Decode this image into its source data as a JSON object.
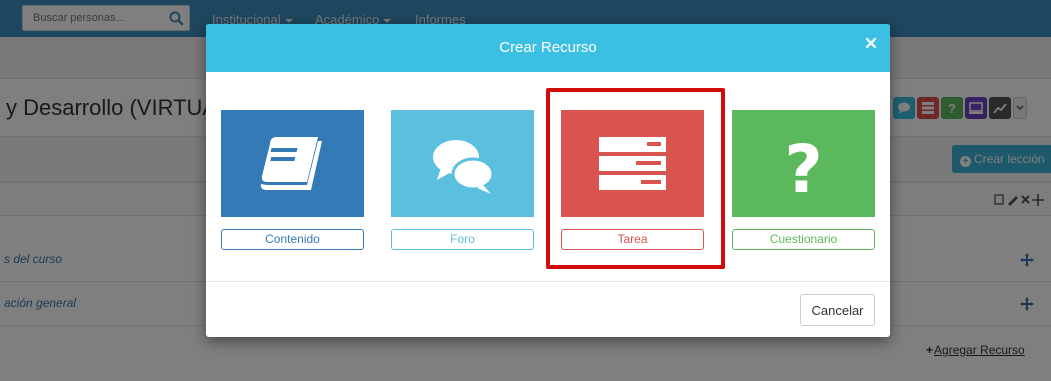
{
  "topbar": {
    "search_placeholder": "Buscar personas...",
    "nav": [
      {
        "label": "Institucional",
        "has_caret": true
      },
      {
        "label": "Académico",
        "has_caret": true
      },
      {
        "label": "Informes",
        "has_caret": false
      }
    ]
  },
  "page": {
    "course_title": "y Desarrollo (VIRTUAL)",
    "crear_leccion_label": "Crear lección",
    "rows": [
      {
        "label": "s del curso"
      },
      {
        "label": "ación general"
      }
    ],
    "agregar_recurso_label": "Agregar Recurso"
  },
  "modal": {
    "title": "Crear Recurso",
    "close_glyph": "×",
    "tiles": [
      {
        "label": "Contenido",
        "color": "#337ab7"
      },
      {
        "label": "Foro",
        "color": "#5bc0de"
      },
      {
        "label": "Tarea",
        "color": "#d9534f"
      },
      {
        "label": "Cuestionario",
        "color": "#5cb85c"
      }
    ],
    "cancel_label": "Cancelar"
  }
}
